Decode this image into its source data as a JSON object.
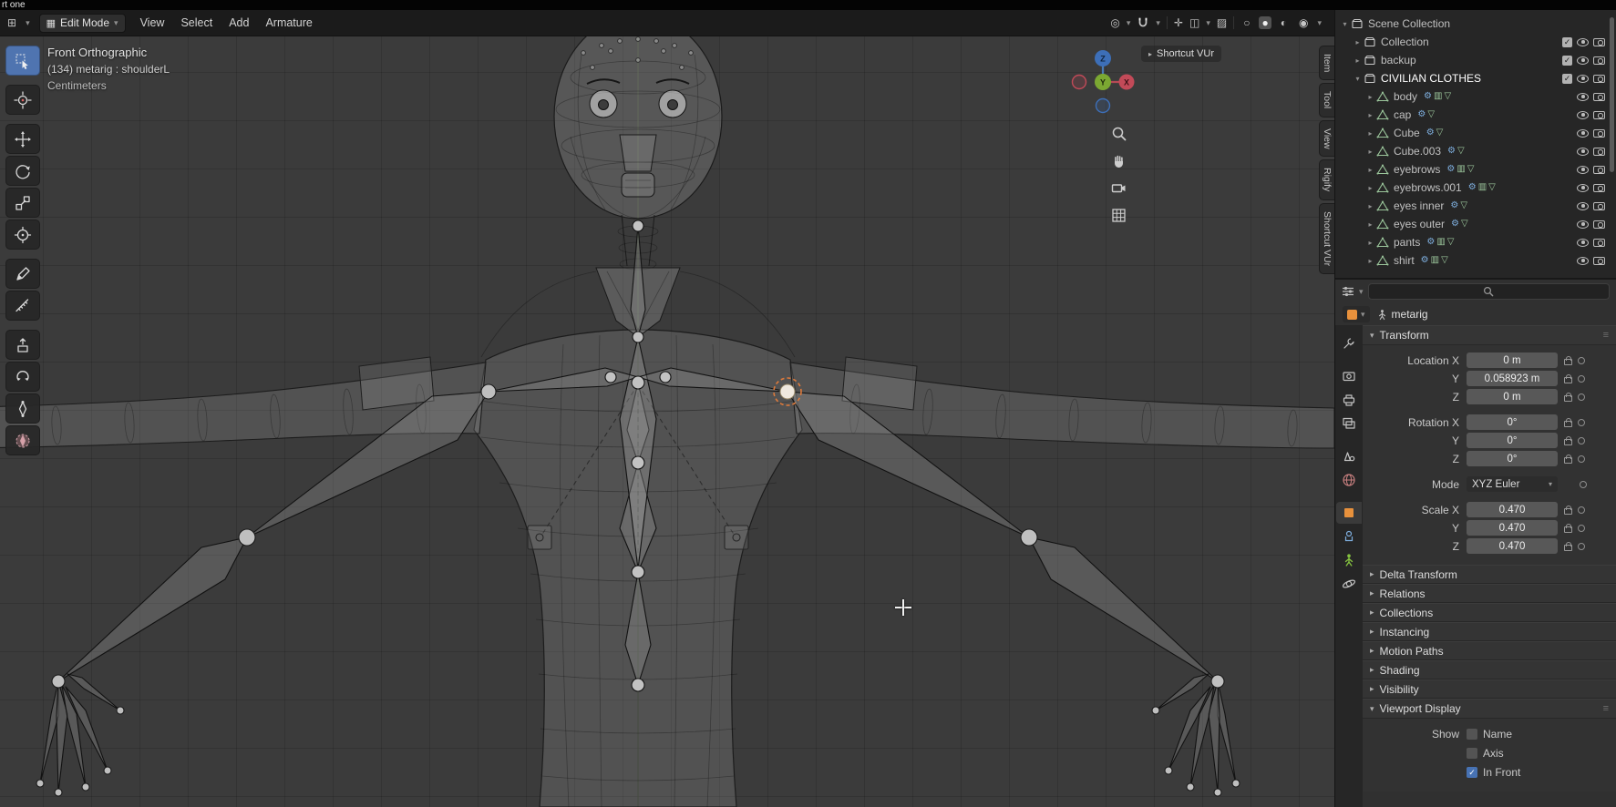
{
  "window": {
    "title": "rt one"
  },
  "topbar": {
    "mode_label": "Edit Mode",
    "menus": [
      "View",
      "Select",
      "Add",
      "Armature"
    ]
  },
  "toolbar": {
    "tools": [
      {
        "name": "tweak-select",
        "active": true
      },
      {
        "name": "cursor-3d",
        "gap": true
      },
      {
        "name": "move",
        "gap": true
      },
      {
        "name": "rotate"
      },
      {
        "name": "scale"
      },
      {
        "name": "transform"
      },
      {
        "name": "annotate",
        "gap": true
      },
      {
        "name": "measure"
      },
      {
        "name": "extrude",
        "gap": true
      },
      {
        "name": "roll"
      },
      {
        "name": "bone-size"
      },
      {
        "name": "bone-envelope"
      }
    ]
  },
  "viewport": {
    "view_label": "Front Orthographic",
    "selection_label": "(134) metarig : shoulderL",
    "units_label": "Centimeters",
    "shortcut_panel_label": "Shortcut VUr",
    "side_tabs": [
      "Item",
      "Tool",
      "View",
      "Rigify",
      "Shortcut VUr"
    ],
    "axis_labels": {
      "x": "X",
      "y": "Y",
      "z": "Z"
    }
  },
  "outliner": {
    "rows": [
      {
        "name": "Scene Collection",
        "depth": 0,
        "icon": "collection",
        "arrow": "down",
        "controls": []
      },
      {
        "name": "Collection",
        "depth": 1,
        "icon": "collection",
        "arrow": "right",
        "controls": [
          "check",
          "eye",
          "camera"
        ]
      },
      {
        "name": "backup",
        "depth": 1,
        "icon": "collection",
        "arrow": "right",
        "controls": [
          "check",
          "eye",
          "camera"
        ]
      },
      {
        "name": "CIVILIAN CLOTHES",
        "depth": 1,
        "icon": "collection",
        "arrow": "down",
        "active": true,
        "controls": [
          "check",
          "eye",
          "camera"
        ]
      },
      {
        "name": "body",
        "depth": 2,
        "icon": "mesh",
        "arrow": "right",
        "badges": [
          "modifier",
          "vgroup",
          "meshdata"
        ],
        "controls": [
          "eye",
          "camera"
        ]
      },
      {
        "name": "cap",
        "depth": 2,
        "icon": "mesh",
        "arrow": "right",
        "badges": [
          "modifier",
          "meshdata"
        ],
        "controls": [
          "eye",
          "camera"
        ]
      },
      {
        "name": "Cube",
        "depth": 2,
        "icon": "mesh",
        "arrow": "right",
        "badges": [
          "modifier",
          "meshdata"
        ],
        "controls": [
          "eye",
          "camera"
        ]
      },
      {
        "name": "Cube.003",
        "depth": 2,
        "icon": "mesh",
        "arrow": "right",
        "badges": [
          "modifier",
          "meshdata"
        ],
        "controls": [
          "eye",
          "camera"
        ]
      },
      {
        "name": "eyebrows",
        "depth": 2,
        "icon": "mesh",
        "arrow": "right",
        "badges": [
          "modifier",
          "vgroup",
          "meshdata"
        ],
        "controls": [
          "eye",
          "camera"
        ]
      },
      {
        "name": "eyebrows.001",
        "depth": 2,
        "icon": "mesh",
        "arrow": "right",
        "badges": [
          "modifier",
          "vgroup",
          "meshdata"
        ],
        "controls": [
          "eye",
          "camera"
        ]
      },
      {
        "name": "eyes inner",
        "depth": 2,
        "icon": "mesh",
        "arrow": "right",
        "badges": [
          "modifier",
          "meshdata"
        ],
        "controls": [
          "eye",
          "camera"
        ]
      },
      {
        "name": "eyes outer",
        "depth": 2,
        "icon": "mesh",
        "arrow": "right",
        "badges": [
          "modifier",
          "meshdata"
        ],
        "controls": [
          "eye",
          "camera"
        ]
      },
      {
        "name": "pants",
        "depth": 2,
        "icon": "mesh",
        "arrow": "right",
        "badges": [
          "modifier",
          "vgroup",
          "meshdata"
        ],
        "controls": [
          "eye",
          "camera"
        ]
      },
      {
        "name": "shirt",
        "depth": 2,
        "icon": "mesh",
        "arrow": "right",
        "badges": [
          "modifier",
          "vgroup",
          "meshdata"
        ],
        "controls": [
          "eye",
          "camera"
        ]
      }
    ]
  },
  "properties": {
    "search": {
      "placeholder": ""
    },
    "breadcrumb": {
      "object": "metarig"
    },
    "tabs": [
      {
        "name": "tool"
      },
      {
        "name": "render",
        "grp": true
      },
      {
        "name": "output"
      },
      {
        "name": "view-layer"
      },
      {
        "name": "scene",
        "grp": true
      },
      {
        "name": "world"
      },
      {
        "name": "object",
        "grp": true,
        "active": true
      },
      {
        "name": "constraints"
      },
      {
        "name": "data"
      },
      {
        "name": "physics"
      }
    ],
    "transform": {
      "title": "Transform",
      "rows": [
        {
          "key": "location-x",
          "label": "Location X",
          "value": "0 m",
          "type": "number"
        },
        {
          "key": "location-y",
          "label": "Y",
          "value": "0.058923 m",
          "type": "number"
        },
        {
          "key": "location-z",
          "label": "Z",
          "value": "0 m",
          "type": "number"
        },
        {
          "key": "rotation-x",
          "label": "Rotation X",
          "value": "0°",
          "type": "number",
          "gap": true
        },
        {
          "key": "rotation-y",
          "label": "Y",
          "value": "0°",
          "type": "number"
        },
        {
          "key": "rotation-z",
          "label": "Z",
          "value": "0°",
          "type": "number"
        },
        {
          "key": "rotation-mode",
          "label": "Mode",
          "value": "XYZ Euler",
          "type": "dropdown",
          "gap": true
        },
        {
          "key": "scale-x",
          "label": "Scale X",
          "value": "0.470",
          "type": "number",
          "gap": true
        },
        {
          "key": "scale-y",
          "label": "Y",
          "value": "0.470",
          "type": "number"
        },
        {
          "key": "scale-z",
          "label": "Z",
          "value": "0.470",
          "type": "number"
        }
      ]
    },
    "collapsed_panels": [
      "Delta Transform",
      "Relations",
      "Collections",
      "Instancing",
      "Motion Paths",
      "Shading",
      "Visibility"
    ],
    "viewport_display": {
      "title": "Viewport Display",
      "show_label": "Show",
      "options": [
        {
          "label": "Name",
          "checked": false
        },
        {
          "label": "Axis",
          "checked": false
        },
        {
          "label": "In Front",
          "checked": true
        }
      ]
    }
  }
}
